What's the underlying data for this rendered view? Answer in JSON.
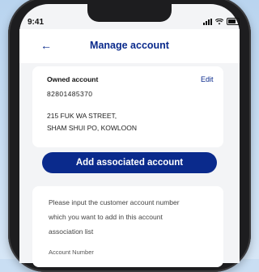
{
  "status_bar": {
    "time": "9:41"
  },
  "header": {
    "back_icon": "back-arrow-icon",
    "title": "Manage account"
  },
  "owned_account": {
    "label": "Owned account",
    "edit_label": "Edit",
    "account_number": "82801485370",
    "address_line1": "215 FUK WA STREET,",
    "address_line2": "SHAM SHUI PO, KOWLOON"
  },
  "add_button_label": "Add associated account",
  "add_form": {
    "instruction_lines": [
      "Please input the customer account number",
      "which you want to add in this account",
      "association list"
    ],
    "field_label": "Account Number"
  },
  "colors": {
    "accent": "#0a2a8c",
    "background": "#c9def3"
  }
}
